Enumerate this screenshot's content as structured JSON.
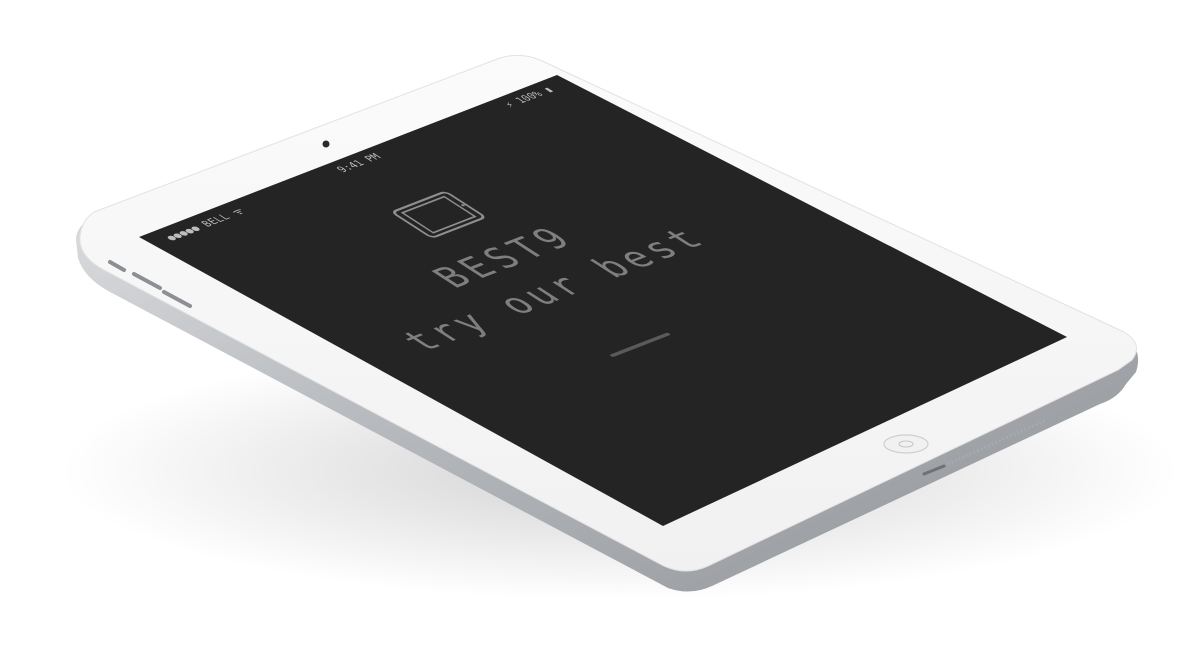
{
  "device": {
    "status_bar": {
      "carrier": "●●●●● BELL ᯤ",
      "time": "9:41 PM",
      "battery": "⚡ 100% ▮"
    },
    "app_icon": "tablet-icon",
    "brand": "BEST9",
    "tagline": "try our best"
  },
  "colors": {
    "screen_bg": "#242425",
    "bezel": "#f6f6f6",
    "frame": "#d4d6d8",
    "text": "#7f7f7f"
  }
}
